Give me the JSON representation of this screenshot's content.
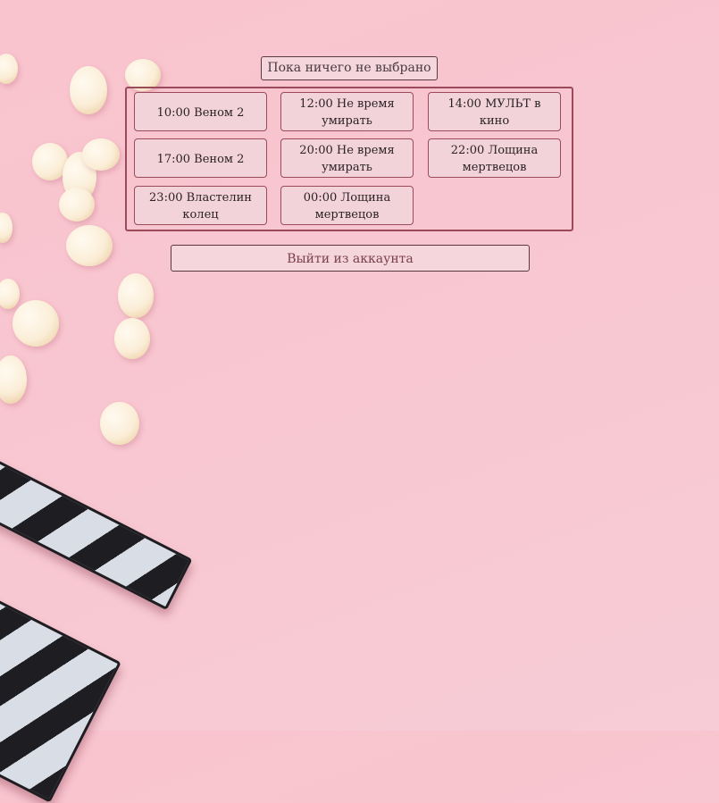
{
  "status": {
    "text": "Пока ничего не выбрано"
  },
  "sessions": [
    {
      "label": "10:00 Веном 2"
    },
    {
      "label": "12:00 Не время умирать"
    },
    {
      "label": "14:00 МУЛЬТ в кино"
    },
    {
      "label": "17:00 Веном 2"
    },
    {
      "label": "20:00 Не время умирать"
    },
    {
      "label": "22:00 Лощина мертвецов"
    },
    {
      "label": "23:00 Властелин колец"
    },
    {
      "label": "00:00 Лощина мертвецов"
    }
  ],
  "actions": {
    "logout_label": "Выйти из аккаунта"
  },
  "theme": {
    "background": "#f8c6d0",
    "button_fill": "#f2d3da",
    "button_border": "#9a4a58",
    "logout_text": "#7b3e4a"
  },
  "background_icons": [
    "popcorn-icon",
    "clapperboard-icon"
  ]
}
